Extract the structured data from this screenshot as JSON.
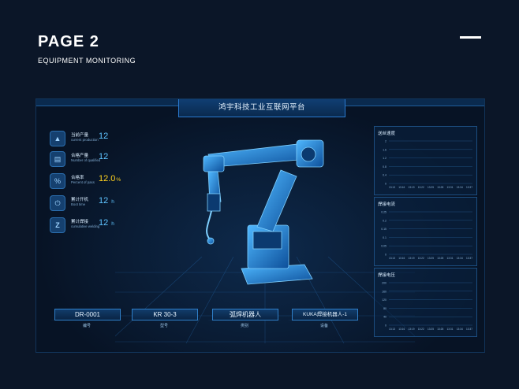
{
  "header": {
    "title": "PAGE 2",
    "subtitle": "EQUIPMENT MONITORING"
  },
  "dashboard": {
    "title": "鸿宇科技工业互联网平台",
    "stats": [
      {
        "icon": "chart-icon",
        "label": "当前产量",
        "label_en": "current production",
        "value": "12",
        "unit": ""
      },
      {
        "icon": "document-icon",
        "label": "合格产量",
        "label_en": "Number of qualified",
        "value": "12",
        "unit": ""
      },
      {
        "icon": "percent-icon",
        "label": "合格率",
        "label_en": "Percent of pass",
        "value": "12.0",
        "unit": "%"
      },
      {
        "icon": "power-icon",
        "label": "累计开机",
        "label_en": "Boot time",
        "value": "12",
        "unit": "h"
      },
      {
        "icon": "z-icon",
        "label": "累计焊接",
        "label_en": "cumulative welding",
        "value": "12",
        "unit": "h"
      }
    ],
    "panels": [
      {
        "title": "送丝速度",
        "yticks": [
          "2",
          "1.6",
          "1.2",
          "0.8",
          "0.4",
          "0"
        ],
        "xticks": [
          "13:13",
          "13:16",
          "13:19",
          "13:22",
          "13:25",
          "13:28",
          "13:31",
          "13:34",
          "13:37"
        ]
      },
      {
        "title": "焊接电流",
        "yticks": [
          "0.25",
          "0.2",
          "0.15",
          "0.1",
          "0.05",
          "0"
        ],
        "xticks": [
          "13:13",
          "13:16",
          "13:19",
          "13:22",
          "13:25",
          "13:28",
          "13:31",
          "13:34",
          "13:37"
        ]
      },
      {
        "title": "焊接电压",
        "yticks": [
          "200",
          "160",
          "120",
          "80",
          "40",
          "0"
        ],
        "xticks": [
          "13:13",
          "13:16",
          "13:19",
          "13:22",
          "13:25",
          "13:28",
          "13:31",
          "13:34",
          "13:37"
        ]
      }
    ],
    "info": [
      {
        "value": "DR-0001",
        "label": "编号"
      },
      {
        "value": "KR 30-3",
        "label": "型号"
      },
      {
        "value": "弧焊机器人",
        "label": "类别"
      },
      {
        "value": "KUKA焊接机器人-1",
        "label": "设备"
      }
    ]
  },
  "colors": {
    "accent": "#5fc4ff",
    "highlight": "#ffd21f",
    "background": "#0b1628"
  }
}
